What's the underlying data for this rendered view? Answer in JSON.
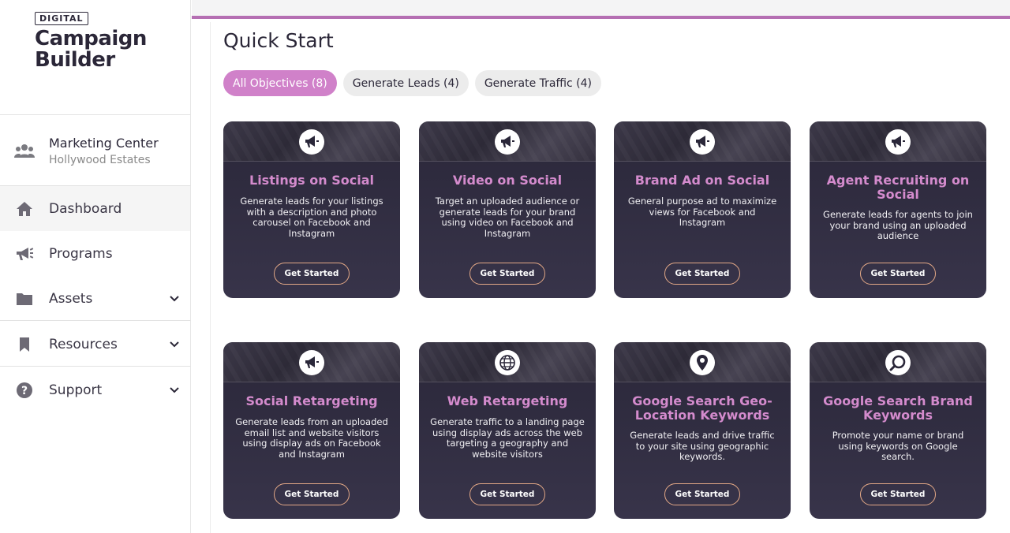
{
  "brand": {
    "badge": "DIGITAL",
    "title_line1": "Campaign",
    "title_line2": "Builder"
  },
  "center": {
    "name": "Marketing Center",
    "subtitle": "Hollywood Estates"
  },
  "nav": {
    "dashboard": "Dashboard",
    "programs": "Programs",
    "assets": "Assets",
    "resources": "Resources",
    "support": "Support"
  },
  "page": {
    "title": "Quick Start"
  },
  "filters": {
    "all": "All Objectives (8)",
    "leads": "Generate Leads (4)",
    "traffic": "Generate Traffic (4)"
  },
  "colors": {
    "accent": "#d081c9",
    "topbar_border": "#b56fb3",
    "card_bg": "#2a2739",
    "card_title": "#d48bcd",
    "button_border": "#e3a886"
  },
  "cards": [
    {
      "icon": "megaphone-icon",
      "title": "Listings on Social",
      "desc": "Generate leads for your listings with a description and photo carousel on Facebook and Instagram",
      "button": "Get Started"
    },
    {
      "icon": "megaphone-icon",
      "title": "Video on Social",
      "desc": "Target an uploaded audience or generate leads for your brand using video on Facebook and Instagram",
      "button": "Get Started"
    },
    {
      "icon": "megaphone-icon",
      "title": "Brand Ad on Social",
      "desc": "General purpose ad to maximize views for Facebook and Instagram",
      "button": "Get Started"
    },
    {
      "icon": "megaphone-icon",
      "title": "Agent Recruiting on Social",
      "desc": "Generate leads for agents to join your brand using an uploaded audience",
      "button": "Get Started"
    },
    {
      "icon": "megaphone-icon",
      "title": "Social Retargeting",
      "desc": "Generate leads from an uploaded email list and website visitors using display ads on Facebook and Instagram",
      "button": "Get Started"
    },
    {
      "icon": "globe-icon",
      "title": "Web Retargeting",
      "desc": "Generate traffic to a landing page using display ads across the web targeting a geography and website visitors",
      "button": "Get Started"
    },
    {
      "icon": "map-pin-icon",
      "title": "Google Search Geo-Location Keywords",
      "desc": "Generate leads and drive traffic to your site using geographic keywords.",
      "button": "Get Started"
    },
    {
      "icon": "search-icon",
      "title": "Google Search Brand Keywords",
      "desc": "Promote your name or brand using keywords on Google search.",
      "button": "Get Started"
    }
  ]
}
